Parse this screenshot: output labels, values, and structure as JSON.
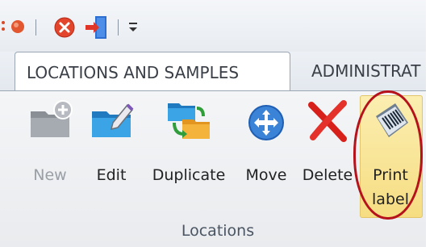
{
  "quick_access": {
    "icons": [
      "bullet-icon",
      "close-icon",
      "exit-door-icon",
      "customize-dropdown-icon"
    ]
  },
  "tabs": [
    {
      "label": "LOCATIONS AND SAMPLES",
      "active": true
    },
    {
      "label": "ADMINISTRAT",
      "active": false
    }
  ],
  "ribbon": {
    "group_label": "Locations",
    "buttons": [
      {
        "label": "New",
        "icon": "new-folder-icon",
        "enabled": false
      },
      {
        "label": "Edit",
        "icon": "edit-folder-icon",
        "enabled": true
      },
      {
        "label": "Duplicate",
        "icon": "duplicate-folder-icon",
        "enabled": true
      },
      {
        "label": "Move",
        "icon": "move-icon",
        "enabled": true
      },
      {
        "label": "Delete",
        "icon": "delete-icon",
        "enabled": true
      },
      {
        "label_line1": "Print",
        "label_line2": "label",
        "icon": "barcode-icon",
        "enabled": true,
        "highlighted": true
      }
    ]
  },
  "colors": {
    "highlight": "#f6dd82",
    "annotation_circle": "#b5121b",
    "disabled_text": "#9a9fa6"
  }
}
